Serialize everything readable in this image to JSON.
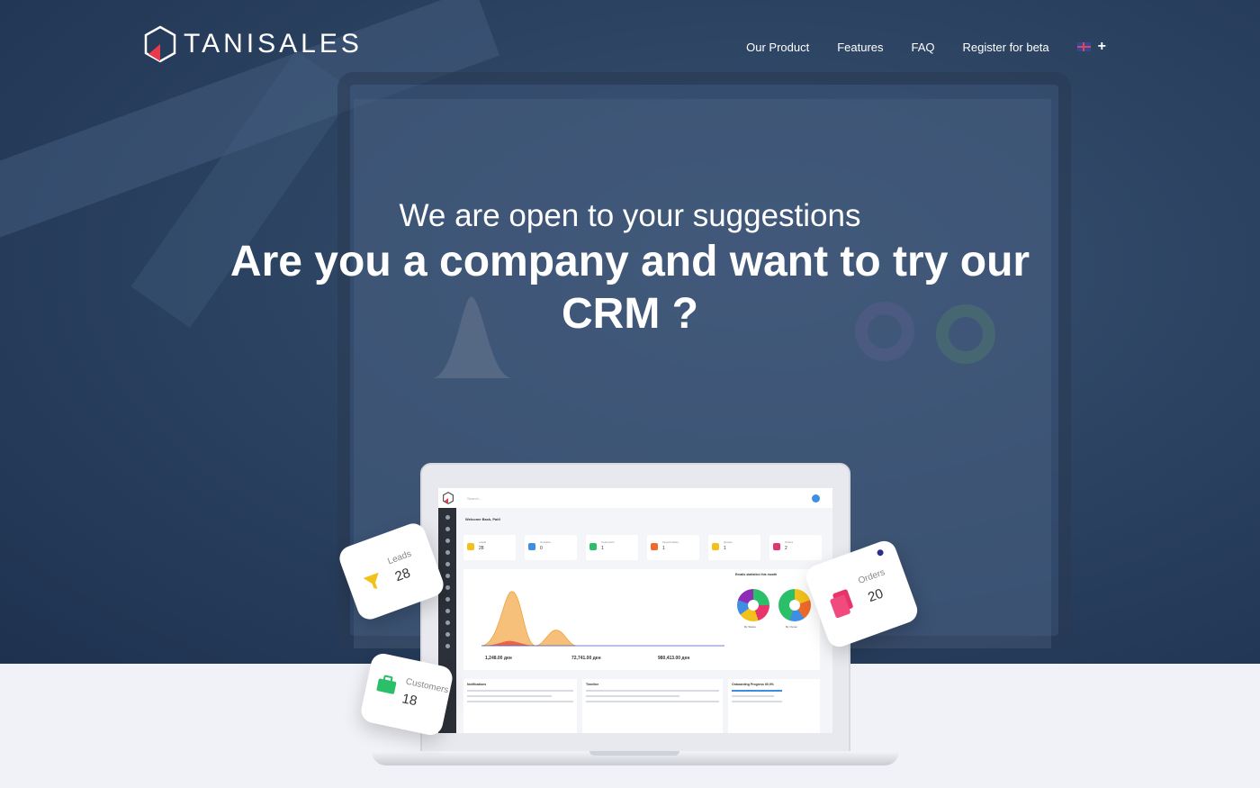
{
  "brand": {
    "name": "TANISALES"
  },
  "nav": {
    "items": [
      {
        "label": "Our Product"
      },
      {
        "label": "Features"
      },
      {
        "label": "FAQ"
      },
      {
        "label": "Register for beta"
      }
    ],
    "language_icon": "uk-flag-icon",
    "more_label": "+"
  },
  "hero": {
    "subtitle": "We are open to your suggestions",
    "title": "Are you a company and want to try our CRM ?"
  },
  "mockup": {
    "search_placeholder": "Search...",
    "welcome": "Welcome Back, Pati!",
    "stats": [
      {
        "label": "Leads",
        "value": "28",
        "color": "#f2c21b"
      },
      {
        "label": "Contacts",
        "value": "0",
        "color": "#3e8fe3"
      },
      {
        "label": "Customers",
        "value": "1",
        "color": "#2cbf6a"
      },
      {
        "label": "Opportunities",
        "value": "1",
        "color": "#f06a2a"
      },
      {
        "label": "Quotes",
        "value": "1",
        "color": "#f2c21b"
      },
      {
        "label": "Orders",
        "value": "2",
        "color": "#e6356b"
      }
    ],
    "totals": [
      "1,248.00 ден",
      "72,741.00 ден",
      "980,413.00 ден"
    ],
    "stats_title": "Emails statistics this month",
    "donut_labels": [
      "By Status",
      "By Owner"
    ],
    "panels": [
      "Notifications",
      "Timeline",
      "Onboarding Progress 60.0%"
    ]
  },
  "floating_cards": {
    "leads": {
      "label": "Leads",
      "value": "28",
      "icon": "funnel-icon",
      "color": "#f2c21b"
    },
    "orders": {
      "label": "Orders",
      "value": "20",
      "icon": "documents-icon",
      "color": "#e6356b"
    },
    "customers": {
      "label": "Customers",
      "value": "18",
      "icon": "briefcase-icon",
      "color": "#2cbf6a"
    }
  }
}
